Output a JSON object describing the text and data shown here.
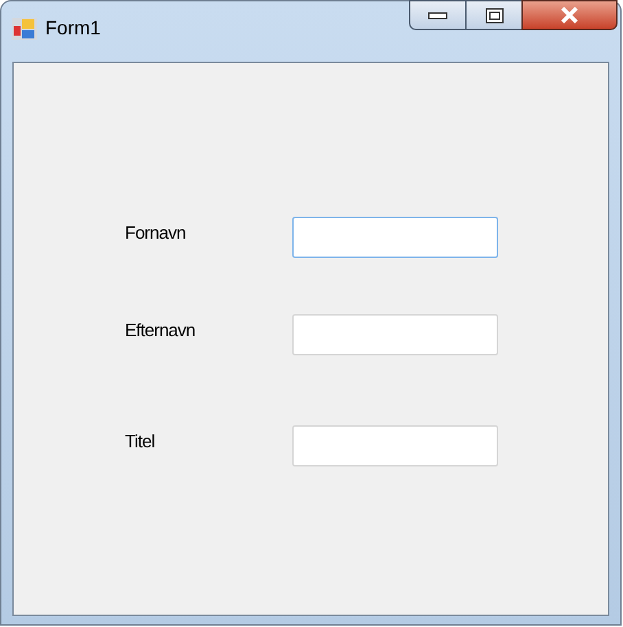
{
  "window": {
    "title": "Form1"
  },
  "fields": [
    {
      "label": "Fornavn",
      "focused": true
    },
    {
      "label": "Efternavn",
      "focused": false
    },
    {
      "label": "Titel",
      "focused": false
    }
  ]
}
